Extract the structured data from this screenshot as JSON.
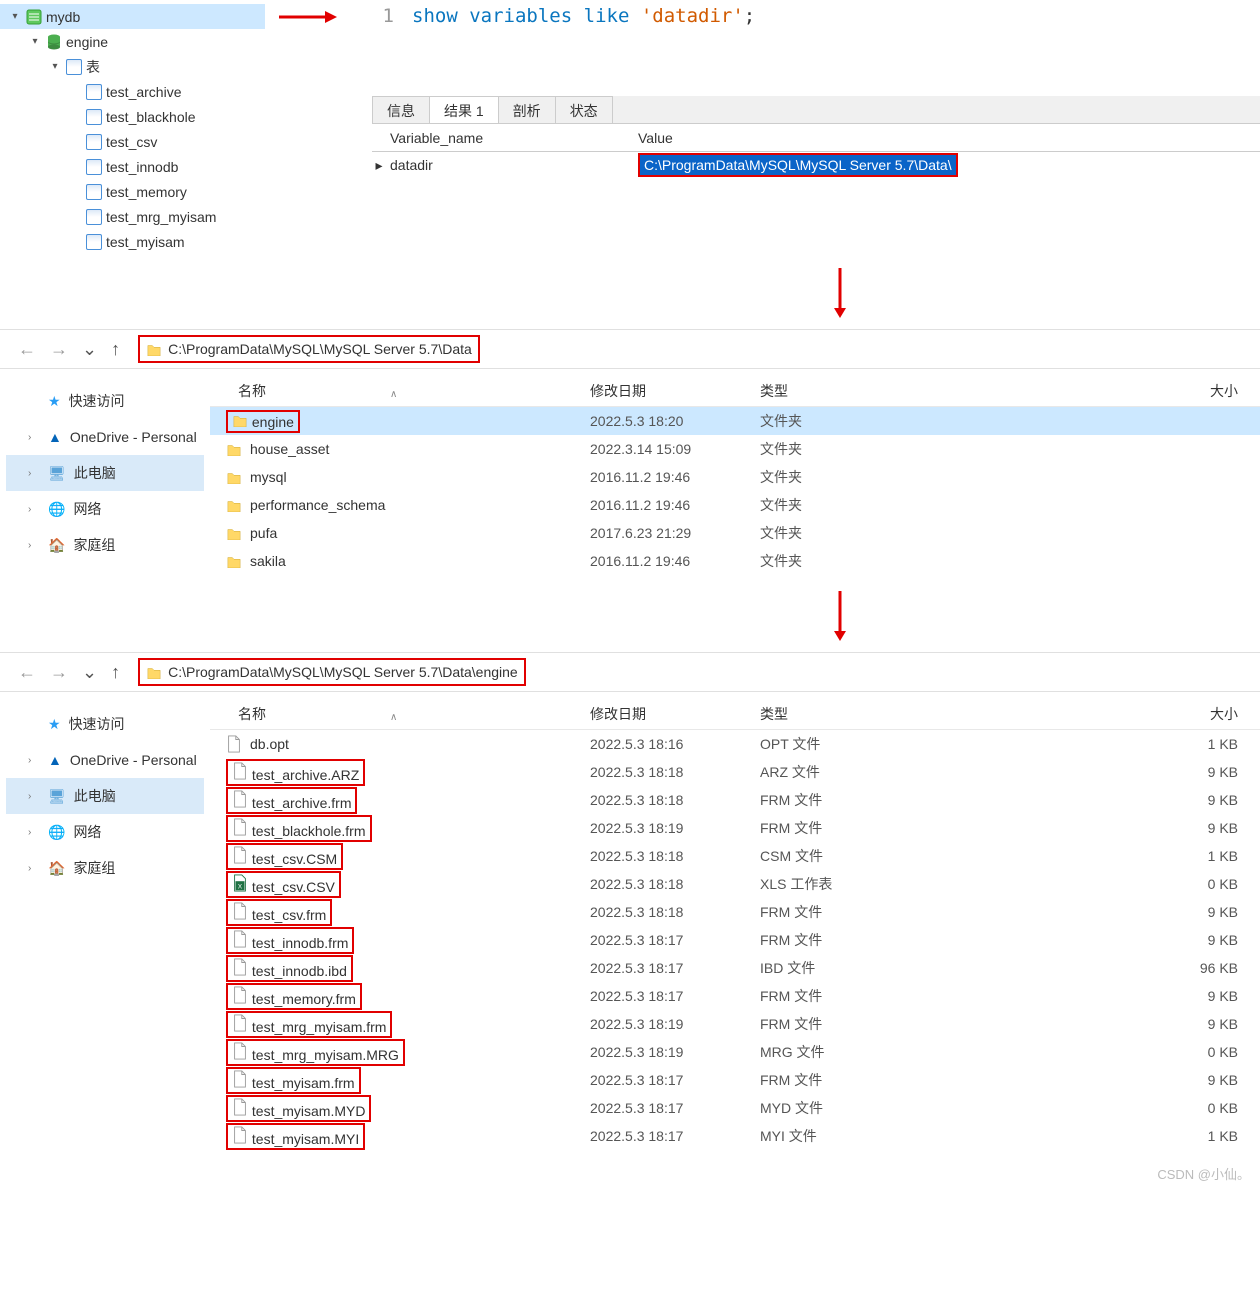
{
  "tree": {
    "db": "mydb",
    "schema": "engine",
    "group": "表",
    "tables": [
      "test_archive",
      "test_blackhole",
      "test_csv",
      "test_innodb",
      "test_memory",
      "test_mrg_myisam",
      "test_myisam"
    ]
  },
  "editor": {
    "line1_num": "1",
    "kw1": "show",
    "kw2": "variables",
    "kw3": "like",
    "str": "'datadir'",
    "semi": ";"
  },
  "tabs": {
    "info": "信息",
    "result": "结果 1",
    "profile": "剖析",
    "status": "状态"
  },
  "result": {
    "h1": "Variable_name",
    "h2": "Value",
    "r1c1": "datadir",
    "r1c2": "C:\\ProgramData\\MySQL\\MySQL Server 5.7\\Data\\"
  },
  "explorer1": {
    "path": "C:\\ProgramData\\MySQL\\MySQL Server 5.7\\Data",
    "headers": {
      "name": "名称",
      "date": "修改日期",
      "type": "类型",
      "size": "大小"
    },
    "items": [
      {
        "name": "engine",
        "date": "2022.5.3 18:20",
        "type": "文件夹",
        "folder": true,
        "hl": true,
        "selected": true
      },
      {
        "name": "house_asset",
        "date": "2022.3.14 15:09",
        "type": "文件夹",
        "folder": true
      },
      {
        "name": "mysql",
        "date": "2016.11.2 19:46",
        "type": "文件夹",
        "folder": true
      },
      {
        "name": "performance_schema",
        "date": "2016.11.2 19:46",
        "type": "文件夹",
        "folder": true
      },
      {
        "name": "pufa",
        "date": "2017.6.23 21:29",
        "type": "文件夹",
        "folder": true
      },
      {
        "name": "sakila",
        "date": "2016.11.2 19:46",
        "type": "文件夹",
        "folder": true
      }
    ]
  },
  "sidebar": {
    "quick": "快速访问",
    "onedrive": "OneDrive - Personal",
    "thispc": "此电脑",
    "network": "网络",
    "homegroup": "家庭组"
  },
  "explorer2": {
    "path": "C:\\ProgramData\\MySQL\\MySQL Server 5.7\\Data\\engine",
    "headers": {
      "name": "名称",
      "date": "修改日期",
      "type": "类型",
      "size": "大小"
    },
    "items": [
      {
        "name": "db.opt",
        "date": "2022.5.3 18:16",
        "type": "OPT 文件",
        "size": "1 KB",
        "hl": false
      },
      {
        "name": "test_archive.ARZ",
        "date": "2022.5.3 18:18",
        "type": "ARZ 文件",
        "size": "9 KB",
        "hl": true
      },
      {
        "name": "test_archive.frm",
        "date": "2022.5.3 18:18",
        "type": "FRM 文件",
        "size": "9 KB",
        "hl": true
      },
      {
        "name": "test_blackhole.frm",
        "date": "2022.5.3 18:19",
        "type": "FRM 文件",
        "size": "9 KB",
        "hl": true
      },
      {
        "name": "test_csv.CSM",
        "date": "2022.5.3 18:18",
        "type": "CSM 文件",
        "size": "1 KB",
        "hl": true
      },
      {
        "name": "test_csv.CSV",
        "date": "2022.5.3 18:18",
        "type": "XLS 工作表",
        "size": "0 KB",
        "hl": true,
        "xls": true
      },
      {
        "name": "test_csv.frm",
        "date": "2022.5.3 18:18",
        "type": "FRM 文件",
        "size": "9 KB",
        "hl": true
      },
      {
        "name": "test_innodb.frm",
        "date": "2022.5.3 18:17",
        "type": "FRM 文件",
        "size": "9 KB",
        "hl": true
      },
      {
        "name": "test_innodb.ibd",
        "date": "2022.5.3 18:17",
        "type": "IBD 文件",
        "size": "96 KB",
        "hl": true
      },
      {
        "name": "test_memory.frm",
        "date": "2022.5.3 18:17",
        "type": "FRM 文件",
        "size": "9 KB",
        "hl": true
      },
      {
        "name": "test_mrg_myisam.frm",
        "date": "2022.5.3 18:19",
        "type": "FRM 文件",
        "size": "9 KB",
        "hl": true
      },
      {
        "name": "test_mrg_myisam.MRG",
        "date": "2022.5.3 18:19",
        "type": "MRG 文件",
        "size": "0 KB",
        "hl": true
      },
      {
        "name": "test_myisam.frm",
        "date": "2022.5.3 18:17",
        "type": "FRM 文件",
        "size": "9 KB",
        "hl": true
      },
      {
        "name": "test_myisam.MYD",
        "date": "2022.5.3 18:17",
        "type": "MYD 文件",
        "size": "0 KB",
        "hl": true
      },
      {
        "name": "test_myisam.MYI",
        "date": "2022.5.3 18:17",
        "type": "MYI 文件",
        "size": "1 KB",
        "hl": true
      }
    ]
  },
  "watermark": "CSDN @小仙。"
}
